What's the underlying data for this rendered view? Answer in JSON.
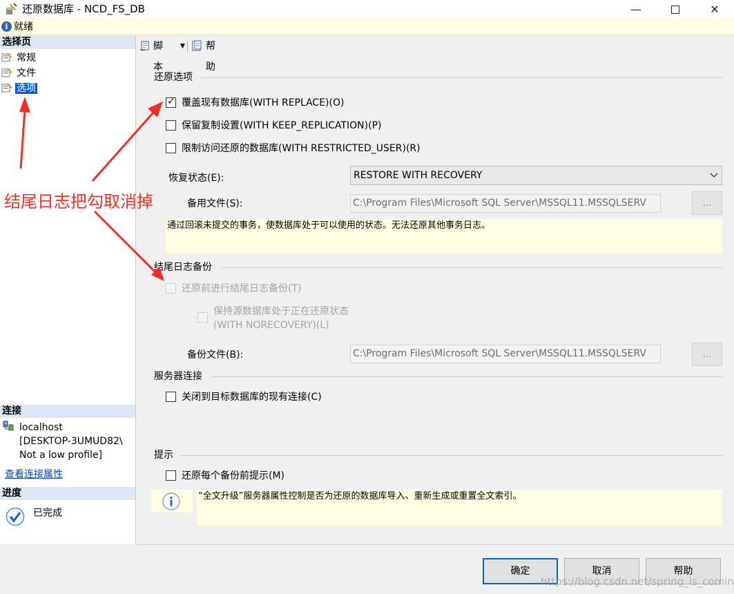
{
  "window": {
    "title": "还原数据库 - NCD_FS_DB",
    "status": "就绪"
  },
  "left": {
    "select_page_header": "选择页",
    "pages": [
      {
        "label": "常规"
      },
      {
        "label": "文件"
      },
      {
        "label": "选项",
        "selected": true
      }
    ],
    "connection_header": "连接",
    "connection_lines": [
      "localhost",
      "[DESKTOP-3UMUD82\\",
      "Not a low profile]"
    ],
    "view_connection_link": "查看连接属性",
    "progress_header": "进度",
    "progress_status": "已完成"
  },
  "toolbar": {
    "script_label": "脚本",
    "help_label": "帮助"
  },
  "restore_options": {
    "title": "还原选项",
    "checkboxes": [
      {
        "label": "覆盖现有数据库(WITH REPLACE)(O)",
        "checked": true
      },
      {
        "label": "保留复制设置(WITH KEEP_REPLICATION)(P)",
        "checked": false
      },
      {
        "label": "限制访问还原的数据库(WITH RESTRICTED_USER)(R)",
        "checked": false
      }
    ],
    "recovery_state_label": "恢复状态(E):",
    "recovery_state_value": "RESTORE WITH RECOVERY",
    "standby_file_label": "备用文件(S):",
    "standby_file_value": "C:\\Program Files\\Microsoft SQL Server\\MSSQL11.MSSQLSERV",
    "browse_label": "...",
    "description": "通过回滚未提交的事务，使数据库处于可以使用的状态。无法还原其他事务日志。"
  },
  "tail_log": {
    "title": "结尾日志备份",
    "backup_before_restore": {
      "label": "还原前进行结尾日志备份(T)",
      "checked": false,
      "enabled": false
    },
    "norecovery_line1": "保持源数据库处于正在还原状态",
    "norecovery_line2": "(WITH NORECOVERY)(L)",
    "norecovery_checked": false,
    "backup_file_label": "备份文件(B):",
    "backup_file_value": "C:\\Program Files\\Microsoft SQL Server\\MSSQL11.MSSQLSERV",
    "browse_label": "..."
  },
  "server_connection": {
    "title": "服务器连接",
    "close_connections": {
      "label": "关闭到目标数据库的现有连接(C)",
      "checked": false
    }
  },
  "prompt": {
    "title": "提示",
    "prompt_each_backup": {
      "label": "还原每个备份前提示(M)",
      "checked": false
    },
    "info_text": "“全文升级”服务器属性控制是否为还原的数据库导入、重新生成或重置全文索引。"
  },
  "buttons": {
    "ok": "确定",
    "cancel": "取消",
    "help": "帮助"
  },
  "annotation": {
    "text": "结尾日志把勾取消掉",
    "color": "#f42d24"
  },
  "watermark": "https://blog.csdn.net/spring_is_coming",
  "colors": {
    "section_header_bg": "#dde7f3",
    "selected_bg": "#0a5fd8",
    "note_bg": "#fffde1",
    "ok_border": "#0a63c9"
  }
}
